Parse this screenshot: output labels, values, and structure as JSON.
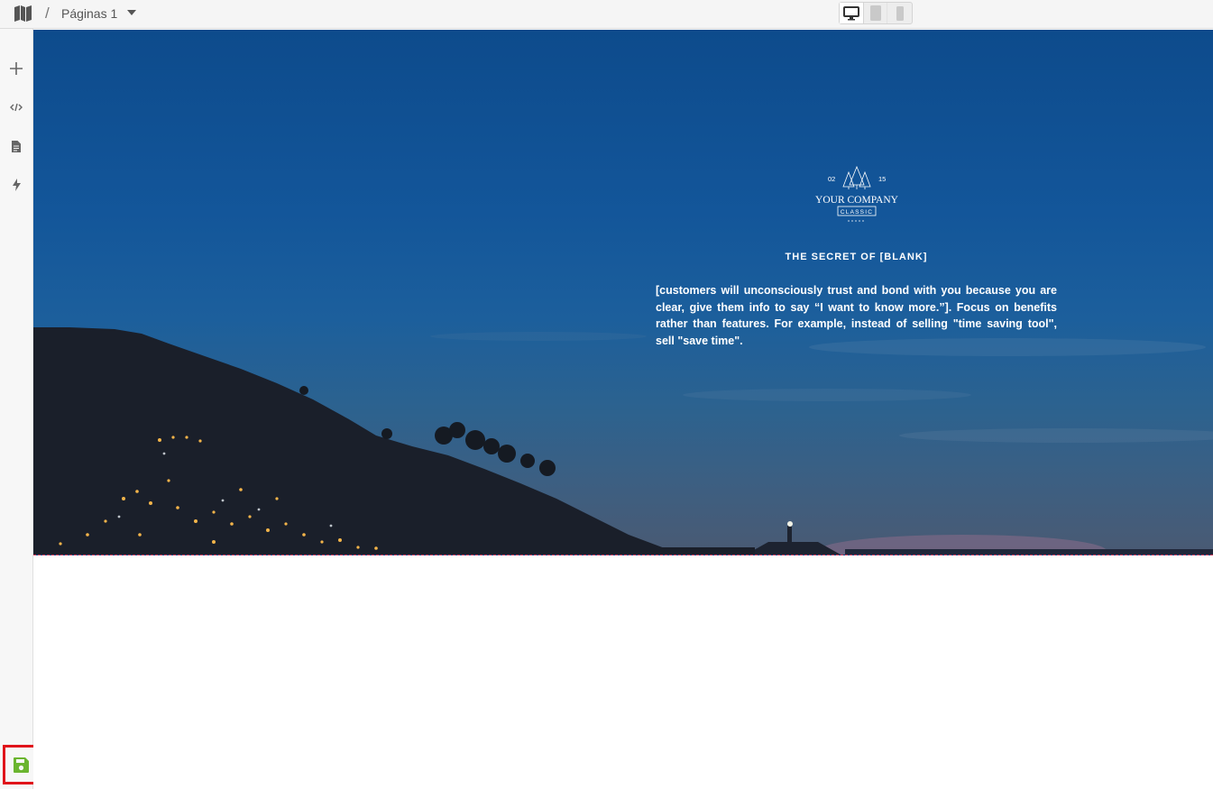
{
  "topbar": {
    "separator": "/",
    "page_selector": "Páginas 1",
    "devices": [
      "desktop-icon",
      "tablet-icon",
      "mobile-icon"
    ]
  },
  "sidebar": {
    "icons": [
      "plus-icon",
      "code-icon",
      "file-icon",
      "bolt-icon"
    ],
    "save_icon": "save-icon"
  },
  "hero": {
    "logo": {
      "left_number": "02",
      "right_number": "15",
      "company": "YOUR COMPANY",
      "tagline": "CLASSIC"
    },
    "heading": "THE SECRET OF [BLANK]",
    "body": "[customers will unconsciously trust and bond with you because you are clear, give them info to say “I want to know more.”]. Focus on benefits rather than features. For example, instead of selling \"time saving tool\", sell \"save time\"."
  },
  "colors": {
    "save_accent": "#6bb52f",
    "highlight_box": "#e0141a",
    "sky_top": "#0d4b8c"
  }
}
